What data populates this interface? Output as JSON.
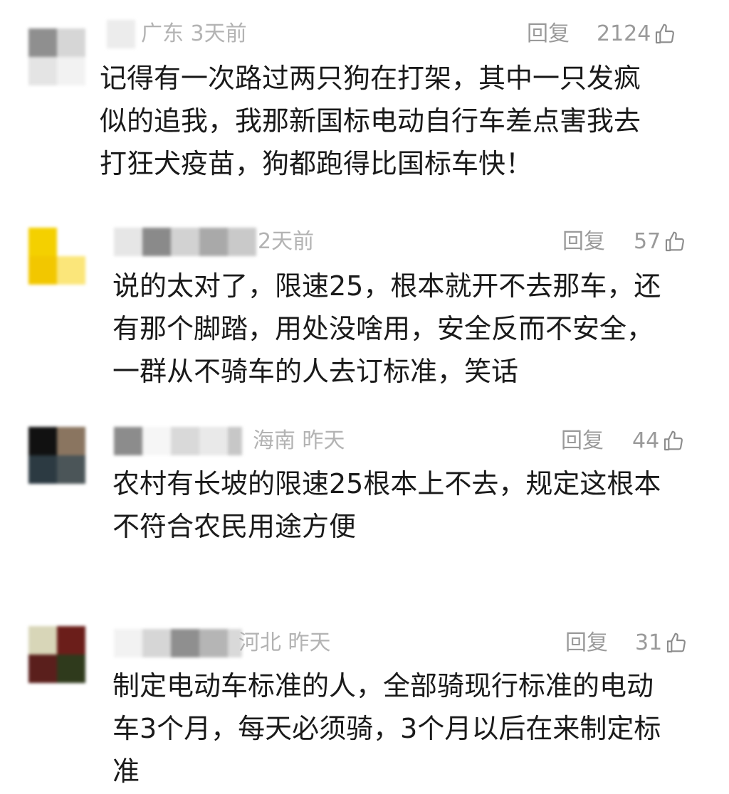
{
  "comments": [
    {
      "location_time": "广东 3天前",
      "reply_label": "回复",
      "likes": "2124",
      "text": "记得有一次路过两只狗在打架，其中一只发疯\n似的追我，我那新国标电动自行车差点害我去\n打狂犬疫苗，狗都跑得比国标车快！",
      "avatar_colors": [
        "#8f8f8f",
        "#d6d6d6",
        "#e4e4e4",
        "#f2f2f2"
      ]
    },
    {
      "location_time": "2天前",
      "reply_label": "回复",
      "likes": "57",
      "text": "说的太对了，限速25，根本就开不去那车，还\n有那个脚踏，用处没啥用，安全反而不安全，\n一群从不骑车的人去订标准，笑话",
      "avatar_colors": [
        "#f4d000",
        "#ffffff",
        "#f2c700",
        "#fbe67a"
      ]
    },
    {
      "location_time": "海南 昨天",
      "reply_label": "回复",
      "likes": "44",
      "text": "农村有长坡的限速25根本上不去，规定这根本\n不符合农民用途方便",
      "avatar_colors": [
        "#111111",
        "#8a7560",
        "#2c3a42",
        "#4b5558"
      ]
    },
    {
      "location_time": "河北 昨天",
      "reply_label": "回复",
      "likes": "31",
      "text": "制定电动车标准的人，全部骑现行标准的电动\n车3个月，每天必须骑，3个月以后在来制定标\n准",
      "avatar_colors": [
        "#d8d6b8",
        "#6b1e1a",
        "#5a1f1c",
        "#2f3a1c"
      ]
    }
  ]
}
